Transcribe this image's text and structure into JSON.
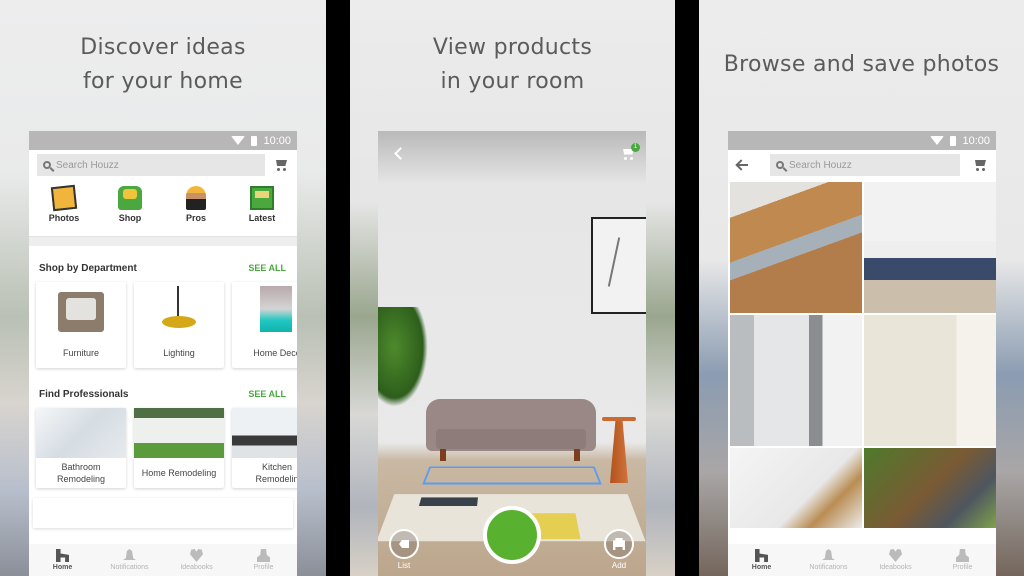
{
  "panels": [
    {
      "caption_lines": [
        "Discover ideas",
        "for your home"
      ],
      "statusbar": {
        "time": "10:00"
      },
      "search": {
        "placeholder": "Search Houzz"
      },
      "categories": [
        {
          "label": "Photos",
          "icon": "photos-icon"
        },
        {
          "label": "Shop",
          "icon": "shop-icon"
        },
        {
          "label": "Pros",
          "icon": "pros-icon"
        },
        {
          "label": "Latest",
          "icon": "latest-icon"
        }
      ],
      "shop_by_department": {
        "title": "Shop by Department",
        "see_all": "SEE ALL",
        "items": [
          {
            "label": "Furniture"
          },
          {
            "label": "Lighting"
          },
          {
            "label": "Home Deco"
          }
        ]
      },
      "find_professionals": {
        "title": "Find Professionals",
        "see_all": "SEE ALL",
        "items": [
          {
            "label_lines": [
              "Bathroom",
              "Remodeling"
            ]
          },
          {
            "label_lines": [
              "Home Remodeling"
            ]
          },
          {
            "label_lines": [
              "Kitchen",
              "Remodelin"
            ]
          }
        ]
      }
    },
    {
      "caption_lines": [
        "View products",
        "in your room"
      ],
      "cart_badge": "1",
      "buttons": {
        "list": "List",
        "add": "Add"
      }
    },
    {
      "caption_lines": [
        "Browse and save photos"
      ],
      "statusbar": {
        "time": "10:00"
      },
      "search": {
        "placeholder": "Search Houzz"
      },
      "photos": [
        {
          "subject": "wood kitchen with island"
        },
        {
          "subject": "white kitchen with navy island"
        },
        {
          "subject": "bathroom with glass shower and tub"
        },
        {
          "subject": "built-in shelves with desk"
        },
        {
          "subject": "white kitchen with brass faucet"
        },
        {
          "subject": "garden with wooden fence"
        }
      ]
    }
  ],
  "bottom_nav": [
    {
      "label": "Home",
      "active": true
    },
    {
      "label": "Notifications",
      "active": false
    },
    {
      "label": "Ideabooks",
      "active": false
    },
    {
      "label": "Profile",
      "active": false
    }
  ],
  "colors": {
    "accent_green": "#4aa83f",
    "caption_gray": "#5b5b5b",
    "ar_placement_blue": "#5a9df0"
  }
}
